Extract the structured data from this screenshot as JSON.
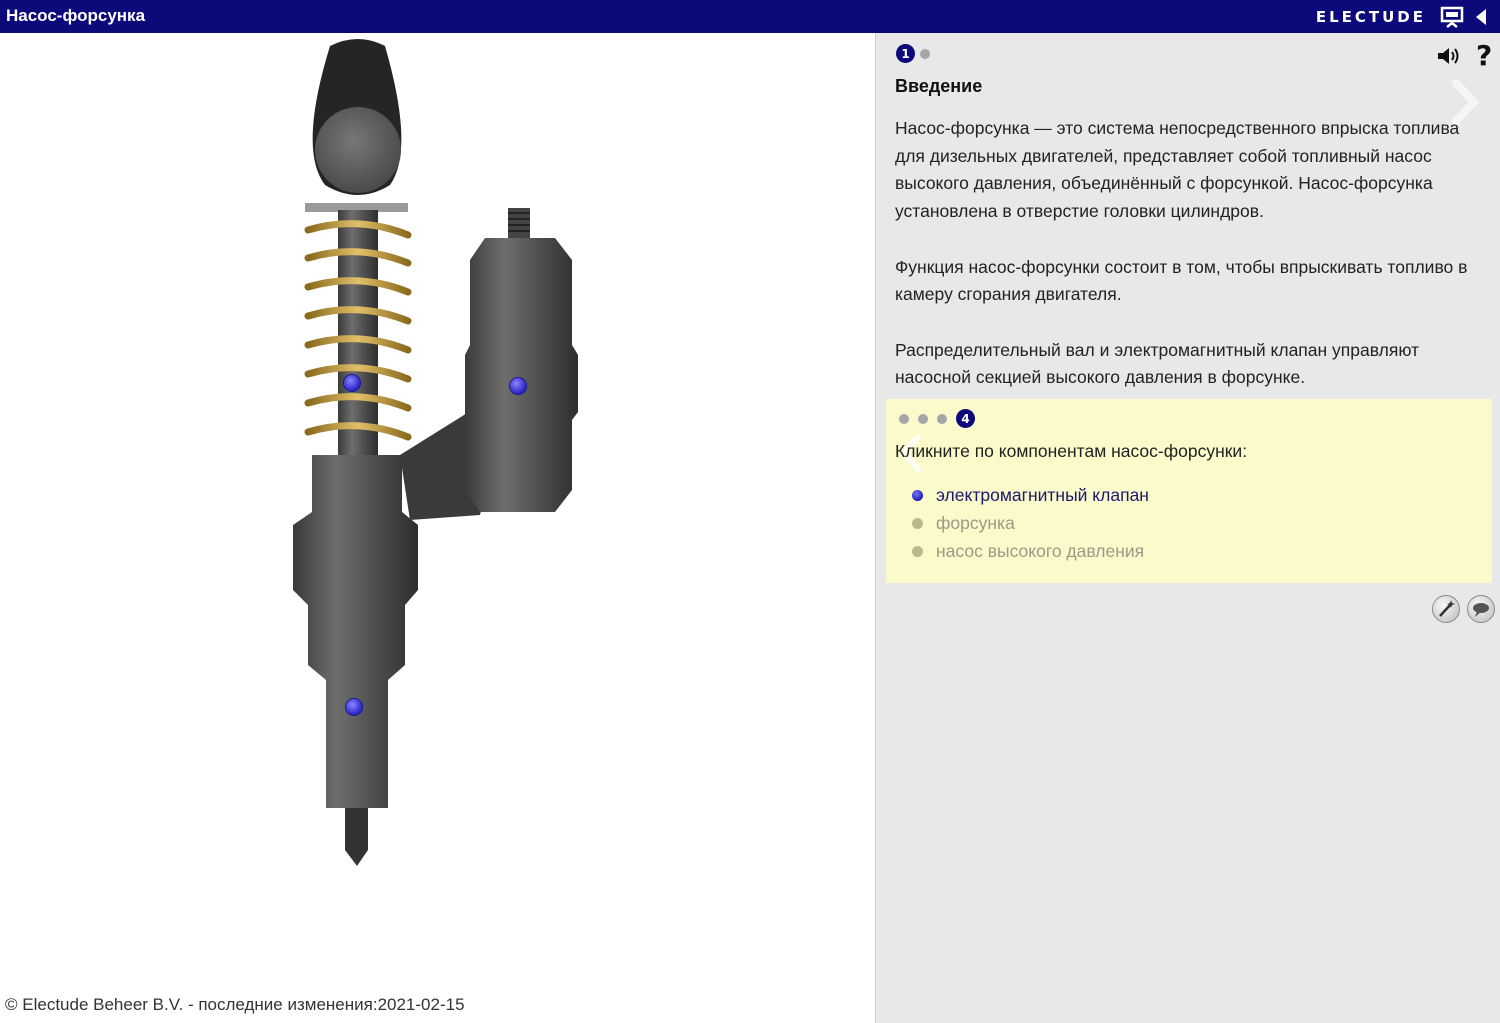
{
  "header": {
    "title": "Насос-форсунка",
    "brand": "ELECTUDE",
    "icons": [
      "presentation-monitor-icon",
      "back-arrow-icon"
    ]
  },
  "illustration": {
    "subject": "unit-injector",
    "hotspots": [
      "solenoid-valve",
      "injector",
      "high-pressure-pump"
    ],
    "footer": "© Electude Beheer B.V. - последние изменения:2021-02-15"
  },
  "panel": {
    "pager": {
      "current": "1",
      "total_dots": 2
    },
    "title": "Введение",
    "paragraphs": [
      "Насос-форсунка — это система непосредственного впрыска топлива для дизельных двигателей, представляет собой топливный насос высокого давления, объединённый с форсункой. Насос-форсунка установлена в отверстие головки цилиндров.",
      "Функция насос-форсунки состоит в том, чтобы впрыскивать топливо в камеру сгорания двигателя.",
      "Распределительный вал и электромагнитный клапан управляют насосной секцией высокого давления в форсунке."
    ],
    "help_label": "?",
    "task": {
      "pager_current": "4",
      "prompt": "Кликните по компонентам насос-форсунки:",
      "items": [
        {
          "label": "электромагнитный клапан",
          "state": "active"
        },
        {
          "label": "форсунка",
          "state": "inactive"
        },
        {
          "label": "насос высокого давления",
          "state": "inactive"
        }
      ]
    },
    "tools": [
      "magic-wand-icon",
      "speech-bubble-icon"
    ]
  },
  "colors": {
    "header_bg": "#0c0a7a",
    "panel_bg": "#e8e8e8",
    "task_bg": "#fbfacb",
    "hotspot": "#3b33e0"
  }
}
